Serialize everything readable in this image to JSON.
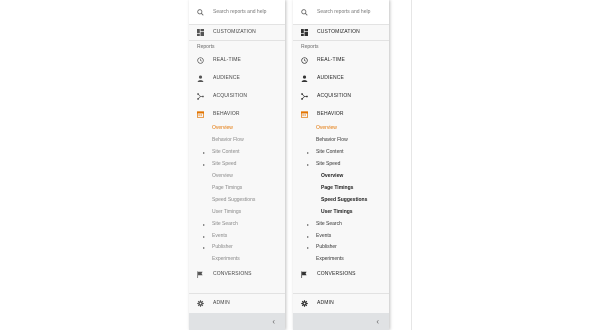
{
  "search": {
    "placeholder": "Search reports and help"
  },
  "customization": {
    "label": "CUSTOMIZATION"
  },
  "reports_section": {
    "label": "Reports"
  },
  "nav": {
    "realtime": "REAL-TIME",
    "audience": "AUDIENCE",
    "acquisition": "ACQUISITION",
    "behavior": "BEHAVIOR",
    "conversions": "CONVERSIONS",
    "admin": "ADMIN"
  },
  "behavior_sub": {
    "overview": "Overview",
    "behavior_flow": "Behavior Flow",
    "site_content": "Site Content",
    "site_speed": "Site Speed",
    "site_speed_children": [
      "Overview",
      "Page Timings",
      "Speed Suggestions",
      "User Timings"
    ],
    "site_search": "Site Search",
    "events": "Events",
    "publisher": "Publisher",
    "experiments": "Experiments"
  },
  "colors": {
    "accent": "#e37400",
    "panel": "#f8f8f8",
    "collapse_bar": "#e0e2e4"
  },
  "collapse": {
    "glyph": "‹"
  },
  "expand_arrow": "▸"
}
